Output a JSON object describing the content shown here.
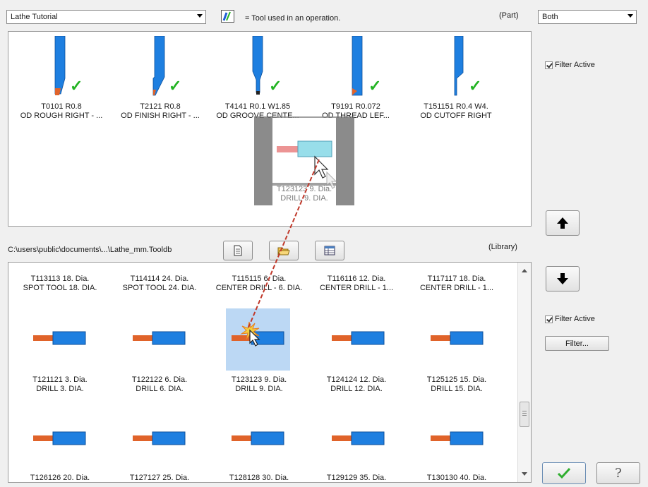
{
  "part": {
    "dropdown_value": "Lathe Tutorial",
    "legend_text": "= Tool used in an operation.",
    "section_label": "(Part)",
    "filter_mode": "Both",
    "filter_active_label": "Filter Active",
    "tools": [
      {
        "line1": "T0101 R0.8",
        "line2": "OD ROUGH RIGHT - ..."
      },
      {
        "line1": "T2121 R0.8",
        "line2": "OD FINISH RIGHT - ..."
      },
      {
        "line1": "T4141 R0.1 W1.85",
        "line2": "OD GROOVE CENTE..."
      },
      {
        "line1": "T9191 R0.072",
        "line2": "OD THREAD LEF..."
      },
      {
        "line1": "T151151 R0.4 W4.",
        "line2": "OD CUTOFF RIGHT"
      }
    ],
    "drag_ghost": {
      "line1": "T123123 9. Dia.",
      "line2": "DRILL 9. DIA."
    }
  },
  "library": {
    "path": "C:\\users\\public\\documents\\...\\Lathe_mm.Tooldb",
    "section_label": "(Library)",
    "filter_active_label": "Filter Active",
    "filter_button": "Filter...",
    "row1": [
      {
        "line1": "T113113 18. Dia.",
        "line2": "SPOT TOOL 18. DIA."
      },
      {
        "line1": "T114114 24. Dia.",
        "line2": "SPOT TOOL 24. DIA."
      },
      {
        "line1": "T115115 6. Dia.",
        "line2": "CENTER DRILL - 6. DIA."
      },
      {
        "line1": "T116116 12. Dia.",
        "line2": "CENTER DRILL - 1..."
      },
      {
        "line1": "T117117 18. Dia.",
        "line2": "CENTER DRILL - 1..."
      }
    ],
    "row2": [
      {
        "line1": "T121121 3. Dia.",
        "line2": "DRILL 3. DIA."
      },
      {
        "line1": "T122122 6. Dia.",
        "line2": "DRILL 6. DIA."
      },
      {
        "line1": "T123123 9. Dia.",
        "line2": "DRILL 9. DIA."
      },
      {
        "line1": "T124124 12. Dia.",
        "line2": "DRILL 12. DIA."
      },
      {
        "line1": "T125125 15. Dia.",
        "line2": "DRILL 15. DIA."
      }
    ],
    "row3": [
      {
        "line1": "T126126 20. Dia."
      },
      {
        "line1": "T127127 25. Dia."
      },
      {
        "line1": "T128128 30. Dia."
      },
      {
        "line1": "T129129 35. Dia."
      },
      {
        "line1": "T130130 40. Dia."
      }
    ]
  },
  "icons": {
    "legend": "tool-used-legend-icon",
    "up": "arrow-up-icon",
    "down": "arrow-down-icon",
    "ok": "checkmark-icon",
    "help": "help-icon"
  },
  "colors": {
    "tool_blue": "#1e7fe0",
    "insert_orange": "#e0632a",
    "used_check": "#22b322",
    "selection": "#bcd8f4",
    "drag_line": "#c0392b"
  }
}
